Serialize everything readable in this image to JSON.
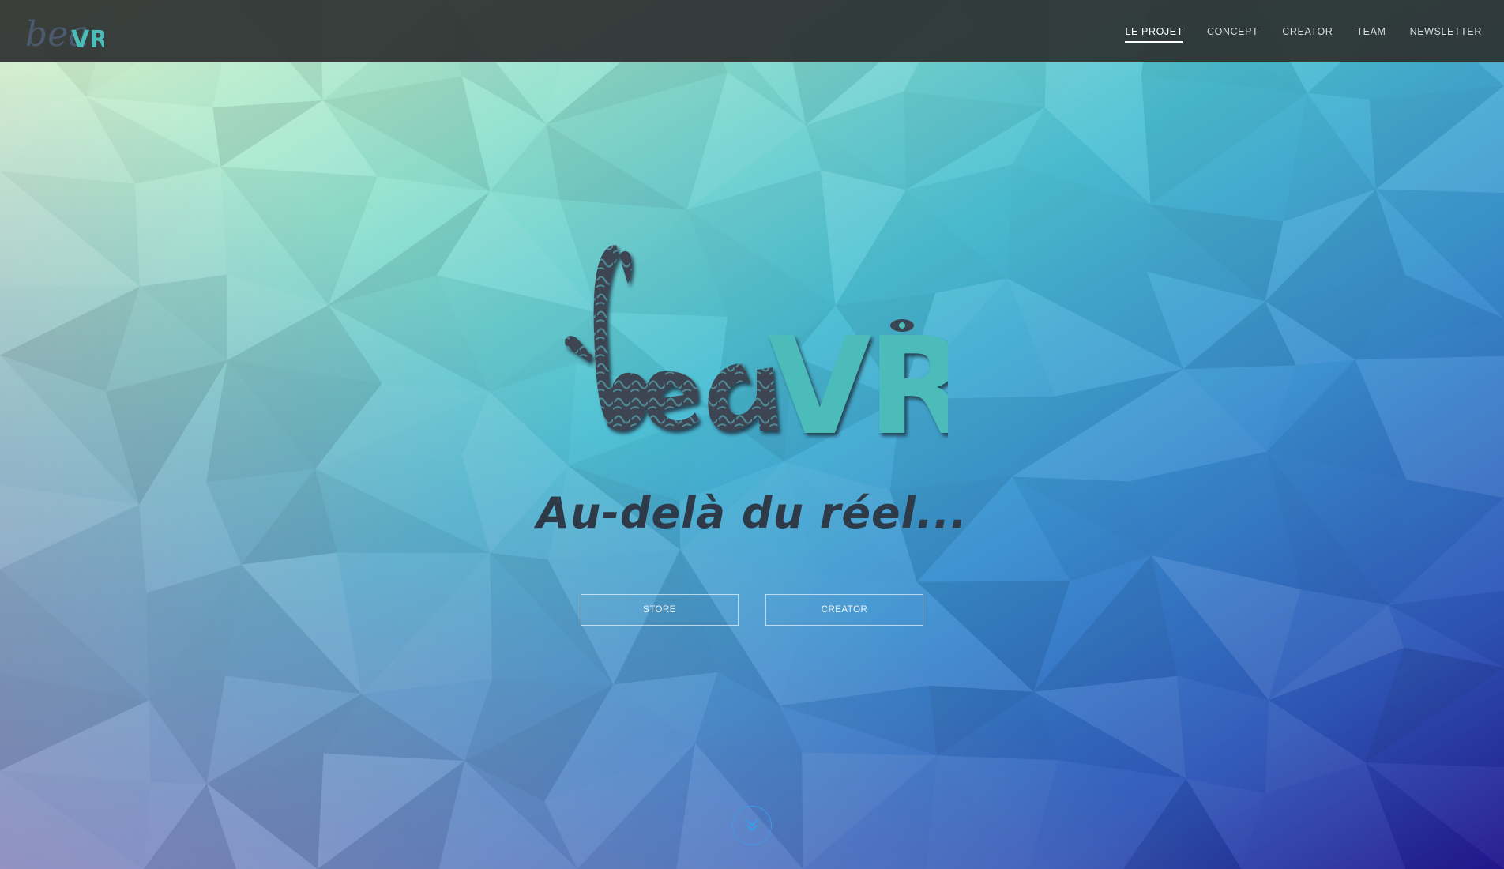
{
  "brand": {
    "logo_text": "beaVR",
    "accent": "#4cbcb9",
    "dark": "#3c4553"
  },
  "nav": {
    "items": [
      {
        "label": "LE PROJET",
        "active": true
      },
      {
        "label": "CONCEPT",
        "active": false
      },
      {
        "label": "CREATOR",
        "active": false
      },
      {
        "label": "TEAM",
        "active": false
      },
      {
        "label": "NEWSLETTER",
        "active": false
      }
    ]
  },
  "hero": {
    "tagline": "Au-delà du réel...",
    "buttons": [
      {
        "label": "STORE"
      },
      {
        "label": "CREATOR"
      }
    ],
    "scroll_icon": "chevron-double-down-icon"
  }
}
